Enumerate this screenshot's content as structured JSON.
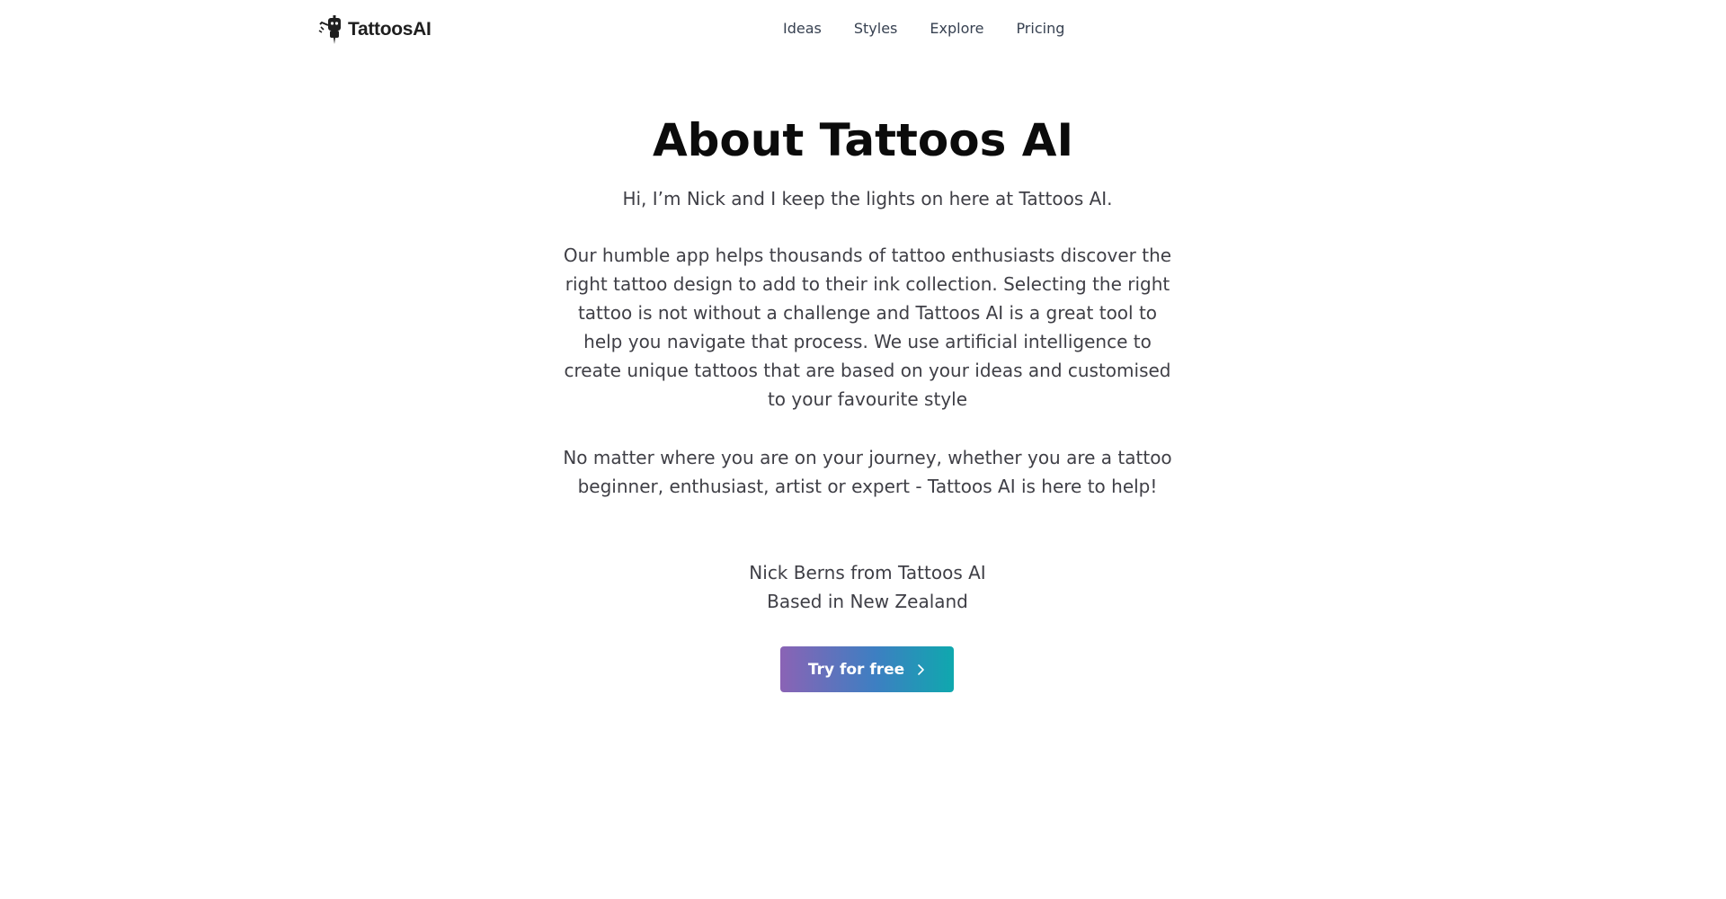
{
  "header": {
    "logo_text": "TattoosAI",
    "logo_icon": "robot-tattoo-machine-icon",
    "nav": [
      {
        "label": "Ideas"
      },
      {
        "label": "Styles"
      },
      {
        "label": "Explore"
      },
      {
        "label": "Pricing"
      }
    ]
  },
  "main": {
    "title": "About Tattoos AI",
    "intro": "Hi, I’m Nick and I keep the lights on here at Tattoos AI.",
    "body_1": "Our humble app helps thousands of tattoo enthusiasts discover the right tattoo design to add to their ink collection. Selecting the right tattoo is not without a challenge and Tattoos AI is a great tool to help you navigate that process. We use artificial intelligence to create unique tattoos that are based on your ideas and customised to your favourite style",
    "body_2": "No matter where you are on your journey, whether you are a tattoo beginner, enthusiast, artist or expert - Tattoos AI is here to help!",
    "signature_name": "Nick Berns from Tattoos AI",
    "signature_location": "Based in New Zealand",
    "cta_label": "Try for free",
    "cta_icon": "chevron-right-icon"
  },
  "colors": {
    "cta_gradient_start": "#8a63b5",
    "cta_gradient_end": "#0fa8ae",
    "text": "#3f3f46",
    "title": "#0b0b0b"
  }
}
